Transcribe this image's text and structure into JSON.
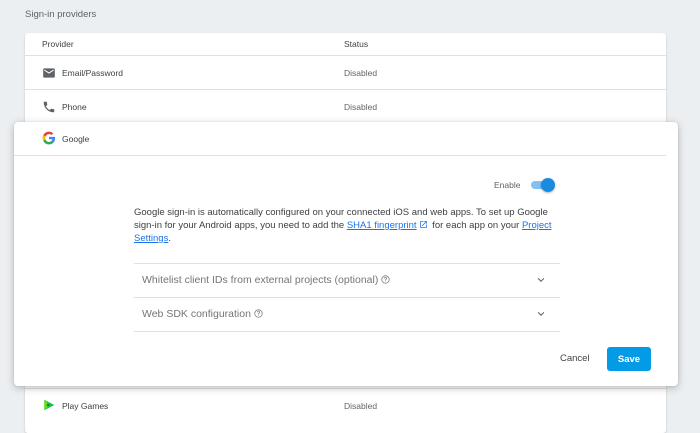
{
  "section_title": "Sign-in providers",
  "table": {
    "headers": {
      "provider": "Provider",
      "status": "Status"
    },
    "rows": [
      {
        "icon": "email-icon",
        "name": "Email/Password",
        "status": "Disabled"
      },
      {
        "icon": "phone-icon",
        "name": "Phone",
        "status": "Disabled"
      }
    ],
    "bottom_row": {
      "icon": "play-games-icon",
      "name": "Play Games",
      "status": "Disabled"
    }
  },
  "modal": {
    "icon": "google-logo-icon",
    "title": "Google",
    "enable_label": "Enable",
    "enabled": true,
    "description": {
      "part1": "Google sign-in is automatically configured on your connected iOS and web apps. To set up Google sign-in for your Android apps, you need to add the ",
      "link1": "SHA1 fingerprint",
      "part2": " for each app on your ",
      "link2": "Project Settings",
      "part3": "."
    },
    "accordion": [
      {
        "label": "Whitelist client IDs from external projects (optional)"
      },
      {
        "label": "Web SDK configuration"
      }
    ],
    "cancel_label": "Cancel",
    "save_label": "Save"
  },
  "colors": {
    "accent": "#039be5",
    "link": "#1a73e8",
    "toggle_on": "#1a8ce0"
  }
}
